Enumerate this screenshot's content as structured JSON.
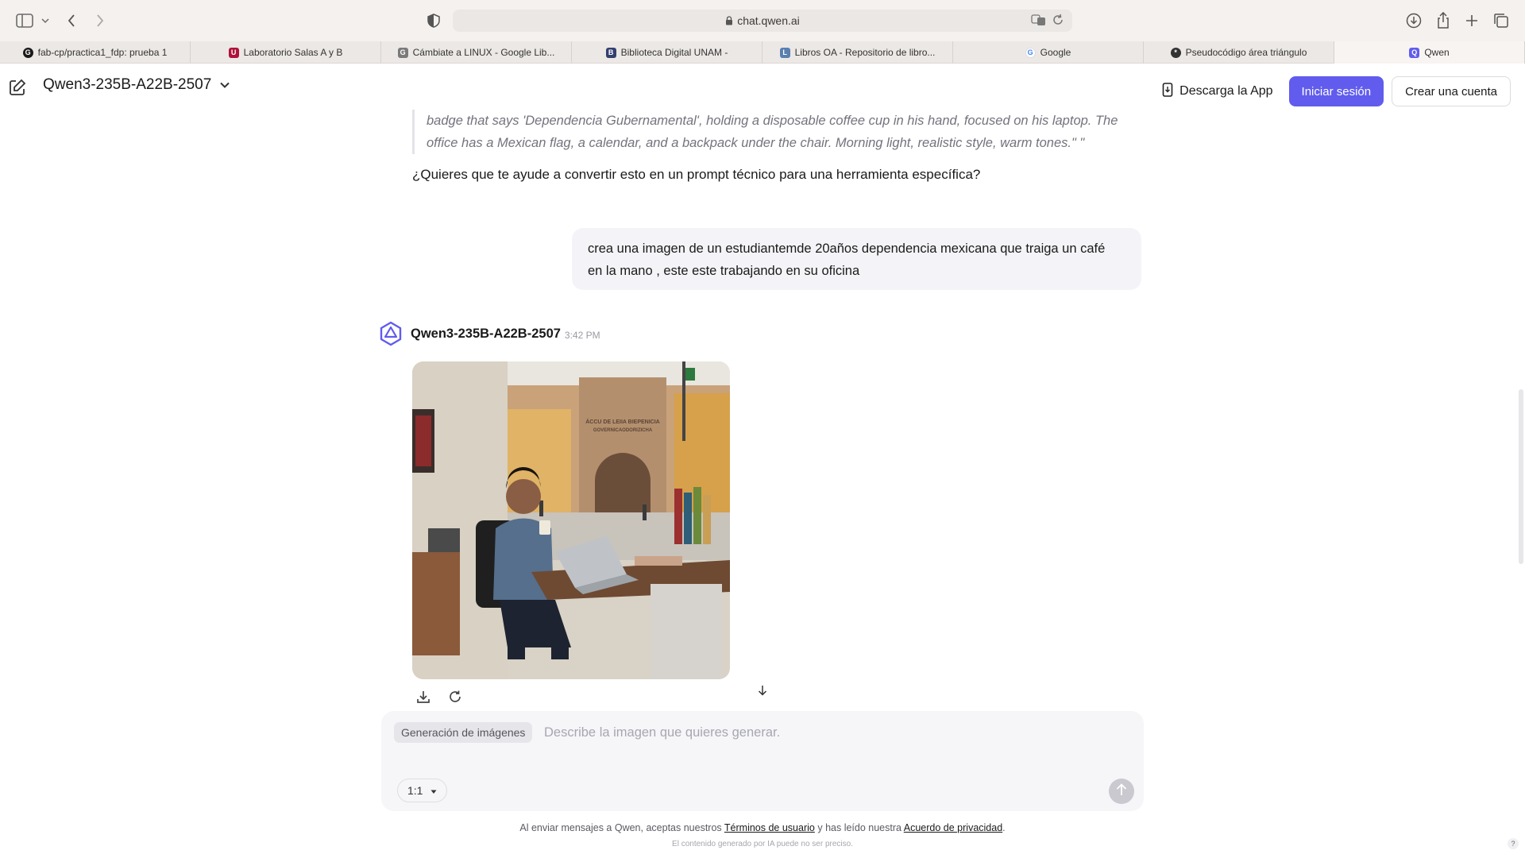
{
  "browser": {
    "url": "chat.qwen.ai",
    "tabs": [
      {
        "label": "fab-cp/practica1_fdp: prueba 1",
        "favicon": "github-icon",
        "color": "#1a1a1a"
      },
      {
        "label": "Laboratorio Salas A y B",
        "favicon": "unam-icon",
        "color": "#b0123a"
      },
      {
        "label": "Cámbiate a LINUX - Google Lib...",
        "favicon": "google-books-icon",
        "color": "#7a7a7a"
      },
      {
        "label": "Biblioteca Digital UNAM -",
        "favicon": "doc-icon",
        "color": "#33406f"
      },
      {
        "label": "Libros OA - Repositorio de libro...",
        "favicon": "oa-icon",
        "color": "#5a7fb0"
      },
      {
        "label": "Google",
        "favicon": "google-icon",
        "color": "#4285f4"
      },
      {
        "label": "Pseudocódigo área triángulo",
        "favicon": "openai-icon",
        "color": "#333333"
      },
      {
        "label": "Qwen",
        "favicon": "qwen-icon",
        "color": "#615ced",
        "active": true
      }
    ]
  },
  "header": {
    "model": "Qwen3-235B-A22B-2507",
    "download_app": "Descarga la App",
    "login": "Iniciar sesión",
    "signup": "Crear una cuenta"
  },
  "chat": {
    "quote_line1": "badge that says 'Dependencia Gubernamental', holding a disposable coffee cup in his hand, focused on his laptop. The",
    "quote_line2": "office has a Mexican flag, a calendar, and a backpack under the chair. Morning light, realistic style, warm tones.\" \"",
    "question": "¿Quieres que te ayude a convertir esto en un prompt técnico para una herramienta específica?",
    "user_line1": "crea una imagen de un estudiantemde 20años  dependencia mexicana que traiga un café",
    "user_line2": "en la mano , este este trabajando en su oficina",
    "bot_name": "Qwen3-235B-A22B-2507",
    "bot_time": "3:42 PM",
    "image_sign_line1": "ÁCCU DE LEIIA BIEPENICIA",
    "image_sign_line2": "GOVERNICAODORIZICHA"
  },
  "composer": {
    "mode": "Generación de imágenes",
    "placeholder": "Describe la imagen que quieres generar.",
    "ratio": "1:1"
  },
  "footer": {
    "prefix": "Al enviar mensajes a Qwen, aceptas nuestros",
    "terms": "Términos de usuario",
    "middle": "y has leído nuestra",
    "privacy": "Acuerdo de privacidad",
    "suffix": ".",
    "disclaimer": "El contenido generado por IA puede no ser preciso.",
    "help": "?"
  },
  "colors": {
    "accent": "#615ced",
    "chrome": "#f5f1ee",
    "bubble": "#f4f4f8"
  }
}
